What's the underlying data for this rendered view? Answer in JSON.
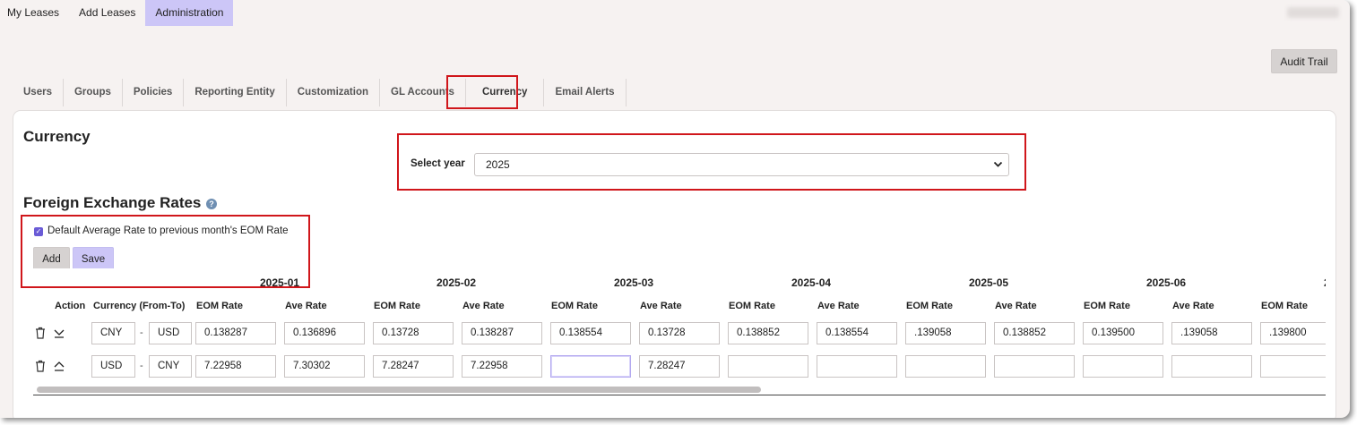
{
  "topnav": {
    "items": [
      "My Leases",
      "Add Leases",
      "Administration"
    ],
    "active_index": 2
  },
  "audit_trail_label": "Audit Trail",
  "tabs": [
    "Users",
    "Groups",
    "Policies",
    "Reporting Entity",
    "Customization",
    "GL Accounts",
    "Currency",
    "Email Alerts"
  ],
  "active_tab": "Currency",
  "page_title": "Currency",
  "year_selector": {
    "label": "Select year",
    "value": "2025"
  },
  "fx_section": {
    "title": "Foreign Exchange Rates",
    "help_icon": "?",
    "default_checkbox_label": "Default Average Rate to previous month's EOM Rate",
    "default_checkbox_checked": true,
    "add_label": "Add",
    "save_label": "Save"
  },
  "table": {
    "action_header": "Action",
    "currency_header": "Currency (From-To)",
    "eom_header": "EOM Rate",
    "ave_header": "Ave Rate",
    "months": [
      "2025-01",
      "2025-02",
      "2025-03",
      "2025-04",
      "2025-05",
      "2025-06",
      "2"
    ],
    "rows": [
      {
        "from": "CNY",
        "to": "USD",
        "separator": "-",
        "toggle": "expand",
        "values": [
          "0.138287",
          "0.136896",
          "0.13728",
          "0.138287",
          "0.138554",
          "0.13728",
          "0.138852",
          "0.138554",
          ".139058",
          "0.138852",
          "0.139500",
          ".139058",
          ".139800"
        ]
      },
      {
        "from": "USD",
        "to": "CNY",
        "separator": "-",
        "toggle": "collapse",
        "values": [
          "7.22958",
          "7.30302",
          "7.28247",
          "7.22958",
          "",
          "7.28247",
          "",
          "",
          "",
          "",
          "",
          "",
          ""
        ]
      }
    ]
  }
}
